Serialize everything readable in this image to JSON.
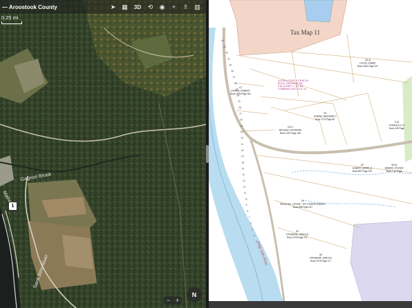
{
  "left_pane": {
    "title": "— Aroostook County",
    "scale_label": "0.25 mi",
    "toolbar": {
      "location": {
        "icon": "location-arrow-icon"
      },
      "map_mode": {
        "icon": "map-icon"
      },
      "view_3d": {
        "label": "3D"
      },
      "directions": {
        "icon": "directions-icon"
      },
      "look_around": {
        "icon": "binoculars-icon"
      },
      "zoom_in": {
        "label": "+"
      },
      "share": {
        "icon": "share-icon"
      },
      "sidebar": {
        "icon": "sidebar-icon"
      }
    },
    "map_labels": {
      "brook": "Gagnon Brook",
      "river": "Saint John River",
      "route": "1",
      "road_left": "Maine"
    },
    "zoom": {
      "minus": "−",
      "plus": "+"
    },
    "compass": "N"
  },
  "right_pane": {
    "map_title": "Tax Map 11",
    "parcels": [
      {
        "id": "22-A",
        "owner": "LOCKE, DANIEL",
        "book": "Book 1551 Page 137"
      },
      {
        "id": "17",
        "owner": "DOWNE, ROBERT",
        "book": "Book 1295 Page 261"
      },
      {
        "id": "15",
        "owner": "DOWNE, BENJAMIN J",
        "book": "Book 1712 Page 89"
      },
      {
        "id": "19-C",
        "owner": "MICHAUD, RAYMOND",
        "book": "Book 1407 Page 155"
      },
      {
        "id": "2-B",
        "owner": "THERIAULT, LE",
        "book": "Book 128 Page"
      },
      {
        "id": "22",
        "owner": "ALBERT, DANIEL B",
        "book": "Book 857 Page 323"
      },
      {
        "id": "29",
        "owner": "BEAULIEU, LOUISE / JUY & MONA NADEAU",
        "book": "Book 898 Page 247"
      },
      {
        "id": "31",
        "owner": "FONGEMIE, HAROLD",
        "book": "Book 1376 Page 117"
      },
      {
        "id": "32",
        "owner": "FONGEMIE, HAROLD",
        "book": "Book 1376 Page 117"
      },
      {
        "id": "40-B",
        "owner": "SIMARD, STEVEN",
        "book": "Book 1.44 Page"
      }
    ],
    "annotation": "1A-PELLETIER & JOHN DA\nBOOK 1284 PAGE 290\n0.50 ACRES +/- 6.1 BG\nCOMBINED INTO LOT 16",
    "lot_numbers": [
      "44",
      "43",
      "42",
      "41",
      "40",
      "36",
      "37",
      "38",
      "35",
      "34",
      "33",
      "28",
      "27",
      "26",
      "25",
      "24",
      "23",
      "21",
      "20",
      "19",
      "18",
      "16",
      "14",
      "13",
      "12",
      "11",
      "10",
      "9",
      "8",
      "7",
      "6",
      "5",
      "4",
      "3",
      "2"
    ],
    "river_label": "Saint John River"
  }
}
